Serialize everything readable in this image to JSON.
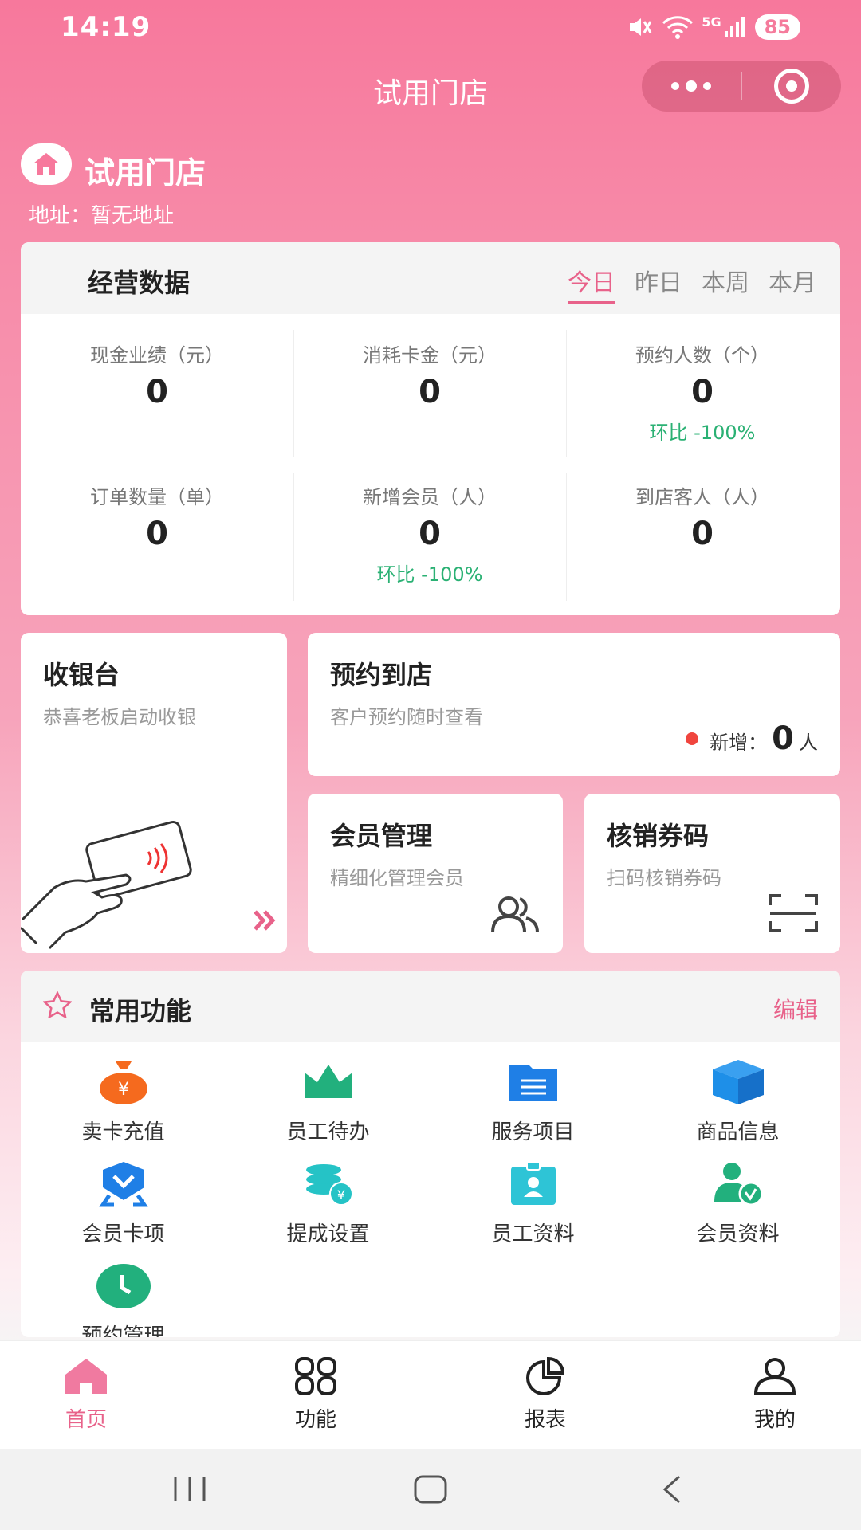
{
  "status": {
    "time": "14:19",
    "network": "5G",
    "battery": "85"
  },
  "nav": {
    "title": "试用门店"
  },
  "store": {
    "name": "试用门店",
    "address": "地址：暂无地址"
  },
  "business": {
    "title": "经营数据",
    "tabs": [
      "今日",
      "昨日",
      "本周",
      "本月"
    ],
    "active_tab": "今日",
    "metrics": [
      {
        "label": "现金业绩（元）",
        "value": "0",
        "compare": ""
      },
      {
        "label": "消耗卡金（元）",
        "value": "0",
        "compare": ""
      },
      {
        "label": "预约人数（个）",
        "value": "0",
        "compare": "环比 -100%"
      },
      {
        "label": "订单数量（单）",
        "value": "0",
        "compare": ""
      },
      {
        "label": "新增会员（人）",
        "value": "0",
        "compare": "环比 -100%"
      },
      {
        "label": "到店客人（人）",
        "value": "0",
        "compare": ""
      }
    ]
  },
  "quick": {
    "cashier": {
      "title": "收银台",
      "subtitle": "恭喜老板启动收银"
    },
    "appointment": {
      "title": "预约到店",
      "subtitle": "客户预约随时查看",
      "new_label": "新增：",
      "new_count": "0",
      "new_unit": "人"
    },
    "member": {
      "title": "会员管理",
      "subtitle": "精细化管理会员"
    },
    "verify": {
      "title": "核销券码",
      "subtitle": "扫码核销券码"
    }
  },
  "common": {
    "title": "常用功能",
    "edit_label": "编辑",
    "items": [
      {
        "label": "卖卡充值",
        "icon": "money-bag-icon",
        "color": "#f56a1e"
      },
      {
        "label": "员工待办",
        "icon": "crown-icon",
        "color": "#22b07d"
      },
      {
        "label": "服务项目",
        "icon": "folder-icon",
        "color": "#1f7fe6"
      },
      {
        "label": "商品信息",
        "icon": "box-icon",
        "color": "#1e8fe8"
      },
      {
        "label": "会员卡项",
        "icon": "badge-icon",
        "color": "#1f7fe6"
      },
      {
        "label": "提成设置",
        "icon": "coins-icon",
        "color": "#25c3c6"
      },
      {
        "label": "员工资料",
        "icon": "id-card-icon",
        "color": "#2ec4d6"
      },
      {
        "label": "会员资料",
        "icon": "member-check-icon",
        "color": "#22b07d"
      },
      {
        "label": "预约管理",
        "icon": "clock-icon",
        "color": "#22b07d"
      }
    ]
  },
  "tabbar": {
    "items": [
      {
        "label": "首页",
        "icon": "home-icon"
      },
      {
        "label": "功能",
        "icon": "grid-icon"
      },
      {
        "label": "报表",
        "icon": "pie-chart-icon"
      },
      {
        "label": "我的",
        "icon": "user-icon"
      }
    ],
    "active": "首页"
  },
  "colors": {
    "brand": "#f7789c",
    "accent": "#e8628a",
    "positive": "#2bb174"
  }
}
